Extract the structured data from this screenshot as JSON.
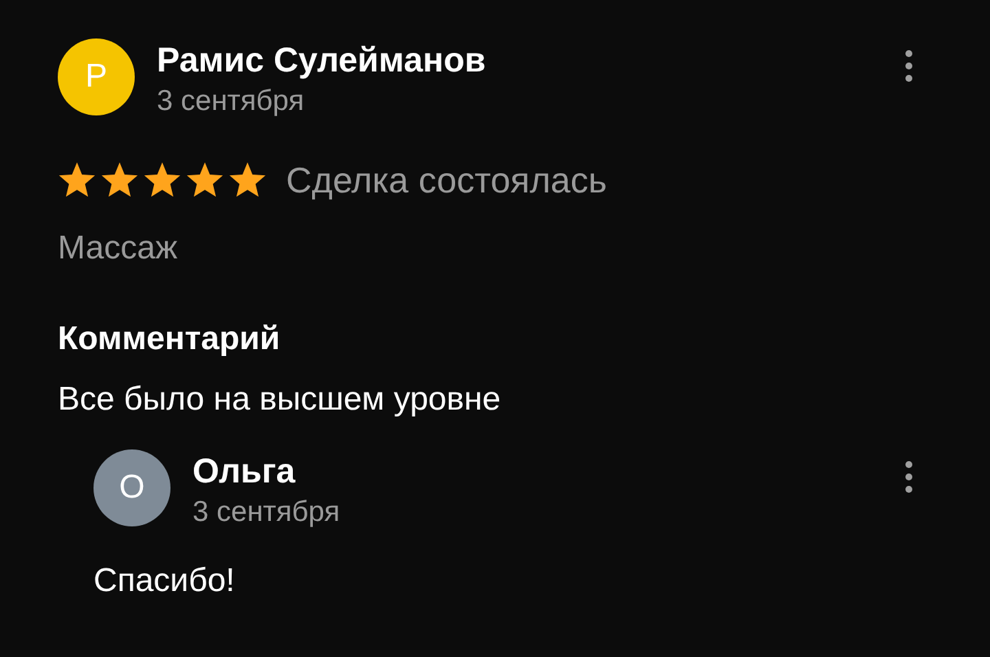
{
  "review": {
    "author": {
      "initial": "Р",
      "name": "Рамис Сулейманов",
      "date": "3 сентября"
    },
    "stars": 5,
    "deal_status": "Сделка состоялась",
    "service": "Массаж",
    "comment_heading": "Комментарий",
    "comment": "Все было на высшем уровне"
  },
  "reply": {
    "author": {
      "initial": "О",
      "name": "Ольга",
      "date": "3 сентября"
    },
    "text": "Спасибо!"
  }
}
